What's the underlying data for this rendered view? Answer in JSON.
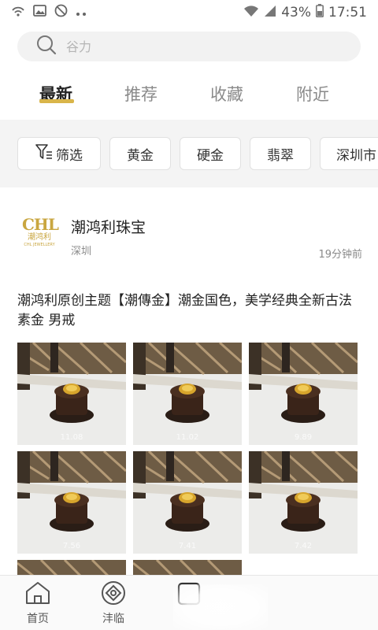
{
  "status": {
    "battery": "43%",
    "time": "17:51",
    "icons": [
      "hotspot-icon",
      "image-icon",
      "no-sync-icon",
      "more-dots-icon",
      "wifi-icon",
      "signal-icon",
      "battery-icon"
    ]
  },
  "search": {
    "placeholder": "谷力"
  },
  "tabs": [
    {
      "label": "最新",
      "active": true
    },
    {
      "label": "推荐",
      "active": false
    },
    {
      "label": "收藏",
      "active": false
    },
    {
      "label": "附近",
      "active": false
    }
  ],
  "filters": {
    "filter_label": "筛选",
    "chips": [
      "黄金",
      "硬金",
      "翡翠",
      "深圳市"
    ]
  },
  "shop": {
    "logo_text": "CHL",
    "logo_sub": "潮鸿利",
    "logo_tiny": "CHL JEWELLERY",
    "name": "潮鸿利珠宝",
    "city": "深圳",
    "time": "19分钟前"
  },
  "post": {
    "title": "潮鸿利原创主题【潮傳金】潮金国色，美学经典全新古法素金 男戒",
    "photo_weights": [
      "11.08",
      "11.02",
      "9.89",
      "7.56",
      "7.41",
      "7.42",
      "",
      ""
    ]
  },
  "bottom_nav": [
    {
      "label": "首页",
      "icon": "home-icon"
    },
    {
      "label": "沣临",
      "icon": "discover-icon"
    },
    {
      "label": "",
      "icon": "publish-icon"
    }
  ],
  "colors": {
    "accent": "#d9b54a",
    "gold": "#c9a640"
  }
}
